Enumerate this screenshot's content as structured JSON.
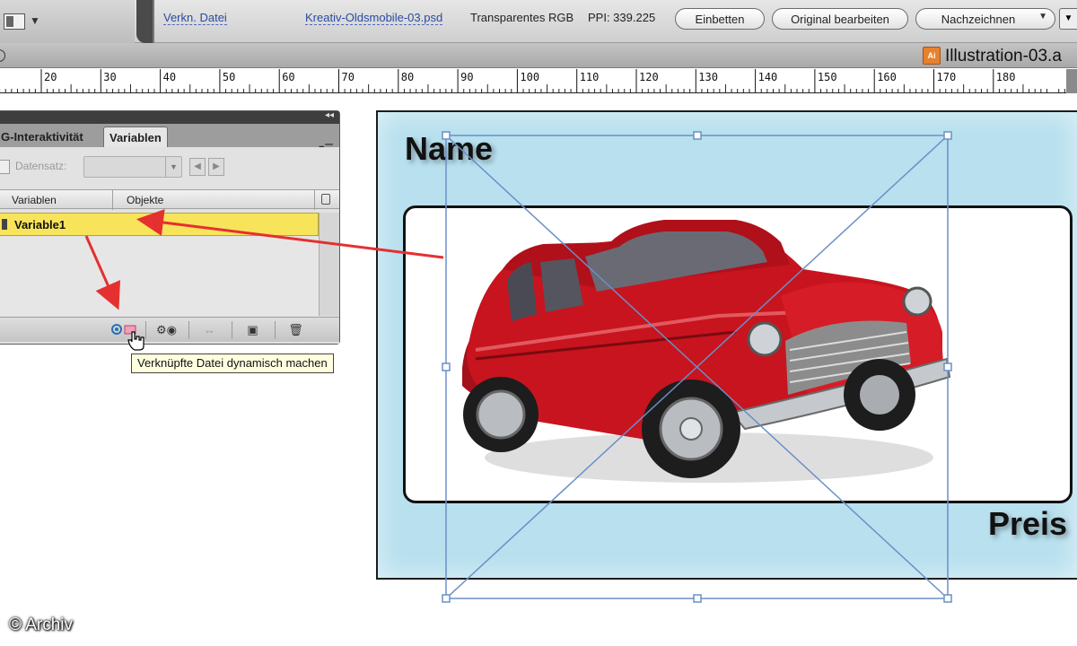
{
  "control_bar": {
    "linked_file_label": "Verkn. Datei",
    "file_name": "Kreativ-Oldsmobile-03.psd",
    "color_mode": "Transparentes RGB",
    "ppi": "PPI: 339.225",
    "buttons": {
      "embed": "Einbetten",
      "edit_original": "Original bearbeiten",
      "trace": "Nachzeichnen"
    }
  },
  "document_tab": {
    "title": "Illustration-03.a",
    "icon_label": "Ai"
  },
  "ruler": {
    "labels": [
      "20",
      "30",
      "40",
      "50",
      "60",
      "70",
      "80",
      "90",
      "100",
      "110",
      "120",
      "130",
      "140",
      "150",
      "160",
      "170",
      "180"
    ]
  },
  "variables_panel": {
    "tabs": [
      "G-Interaktivität",
      "Variablen"
    ],
    "active_tab": "Variablen",
    "dataset_label": "Datensatz:",
    "columns": [
      "Variablen",
      "Objekte"
    ],
    "rows": [
      {
        "name": "Variable1",
        "object": ""
      }
    ]
  },
  "tooltip": {
    "text": "Verknüpfte Datei dynamisch machen"
  },
  "artboard": {
    "name_label": "Name",
    "price_label": "Preis"
  },
  "copyright": "© Archiv",
  "colors": {
    "selection_yellow": "#f7e45a",
    "artboard_blue": "#b8e0ee",
    "arrow_red": "#e53030",
    "bounding_box_blue": "#6b8fc7",
    "car_red": "#c8141e"
  }
}
